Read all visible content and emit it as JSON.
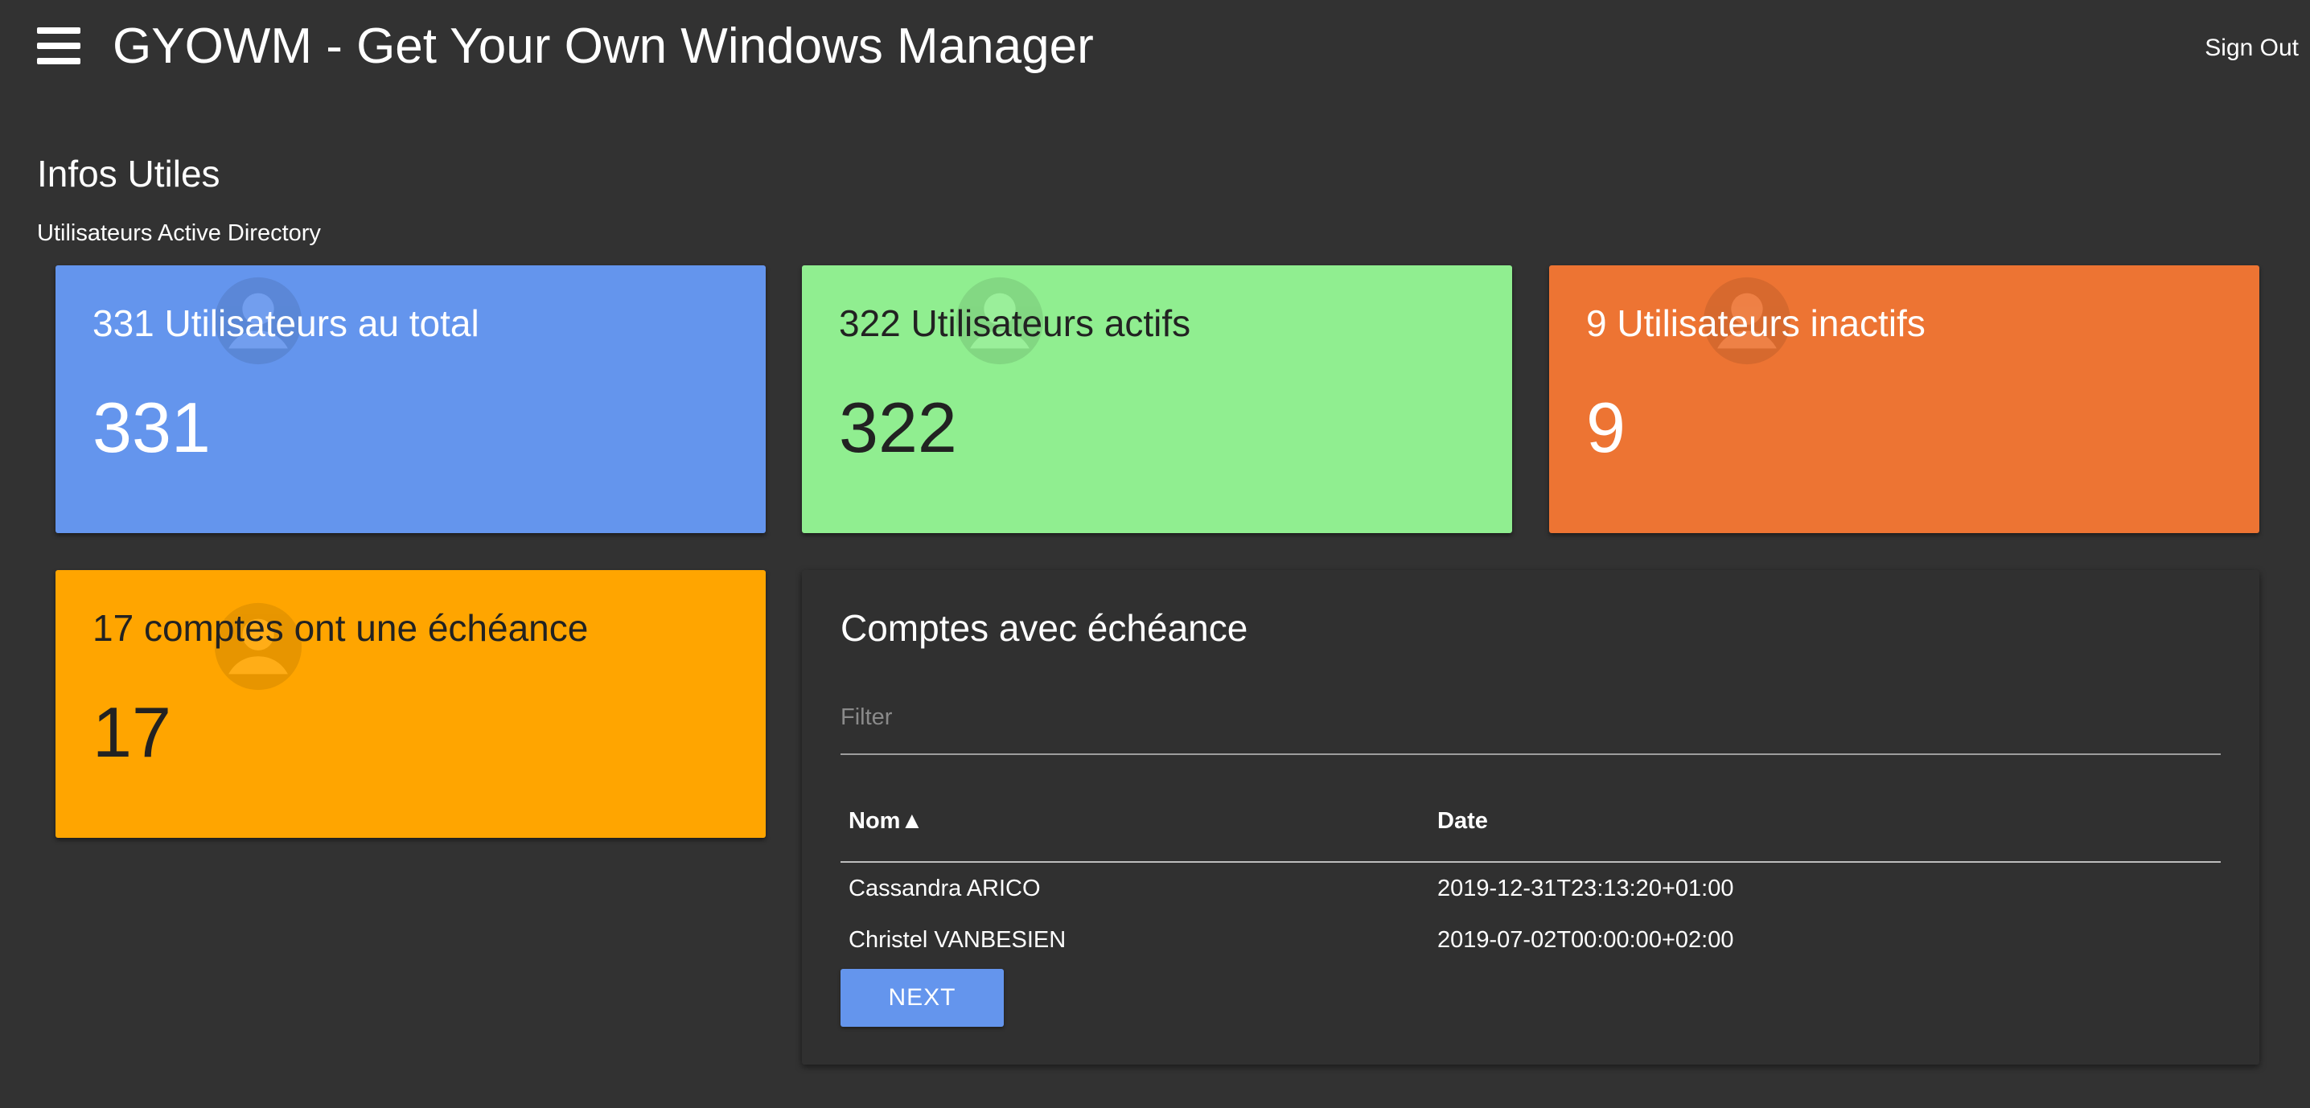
{
  "header": {
    "title": "GYOWM - Get Your Own Windows Manager",
    "sign_out_label": "Sign Out",
    "menu_icon": "hamburger-menu-icon"
  },
  "section": {
    "title": "Infos Utiles",
    "subtitle": "Utilisateurs Active Directory"
  },
  "cards": {
    "total": {
      "label": "331 Utilisateurs au total",
      "value": "331",
      "color": "#6495ed",
      "text_color": "#ffffff",
      "icon": "user-icon"
    },
    "active": {
      "label": "322 Utilisateurs actifs",
      "value": "322",
      "color": "#90ee90",
      "text_color": "#222222",
      "icon": "user-icon"
    },
    "inactive": {
      "label": "9 Utilisateurs inactifs",
      "value": "9",
      "color": "#ed7433",
      "text_color": "#ffffff",
      "icon": "user-icon"
    },
    "expiry": {
      "label": "17 comptes ont une échéance",
      "value": "17",
      "color": "#ffa500",
      "text_color": "#222222",
      "icon": "user-icon"
    }
  },
  "expiry_panel": {
    "title": "Comptes avec échéance",
    "filter_placeholder": "Filter",
    "filter_value": "",
    "columns": {
      "name": "Nom▲",
      "date": "Date"
    },
    "rows": [
      {
        "name": "Cassandra ARICO",
        "date": "2019-12-31T23:13:20+01:00"
      },
      {
        "name": "Christel VANBESIEN",
        "date": "2019-07-02T00:00:00+02:00"
      }
    ],
    "next_label": "NEXT",
    "button_color": "#6495ed"
  }
}
